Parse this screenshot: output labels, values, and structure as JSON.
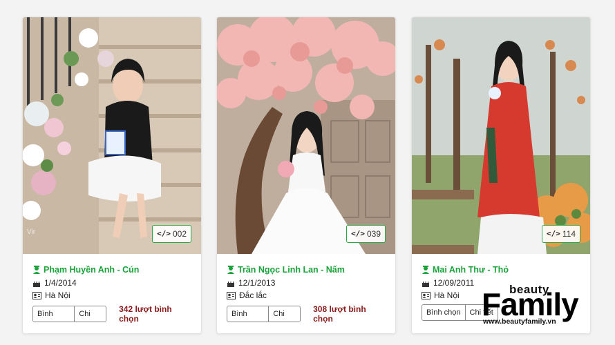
{
  "cards": [
    {
      "code": "002",
      "name": "Phạm Huyền Anh - Cún",
      "dob": "1/4/2014",
      "location": "Hà Nội",
      "vote_label": "Bình chọn",
      "detail_label": "Chi tiết",
      "votes": "342 lượt bình chọn"
    },
    {
      "code": "039",
      "name": "Trần Ngọc Linh Lan - Nấm",
      "dob": "12/1/2013",
      "location": "Đắc lắc",
      "vote_label": "Bình chọn",
      "detail_label": "Chi tiết",
      "votes": "308 lượt bình chọn"
    },
    {
      "code": "114",
      "name": "Mai Anh Thư - Thỏ",
      "dob": "12/09/2011",
      "location": "Hà Nội",
      "vote_label": "Bình chọn",
      "detail_label": "Chi tiết",
      "votes": ""
    }
  ],
  "watermark": {
    "beauty": "beauty",
    "family": "Family",
    "url": "www.beautyfamily.vn"
  },
  "colors": {
    "accent_green": "#1aa33a",
    "votes_red": "#8b1a1a",
    "badge_border": "#27a844"
  },
  "icons": [
    "code-icon",
    "graduate-icon",
    "cake-icon",
    "id-card-icon"
  ]
}
